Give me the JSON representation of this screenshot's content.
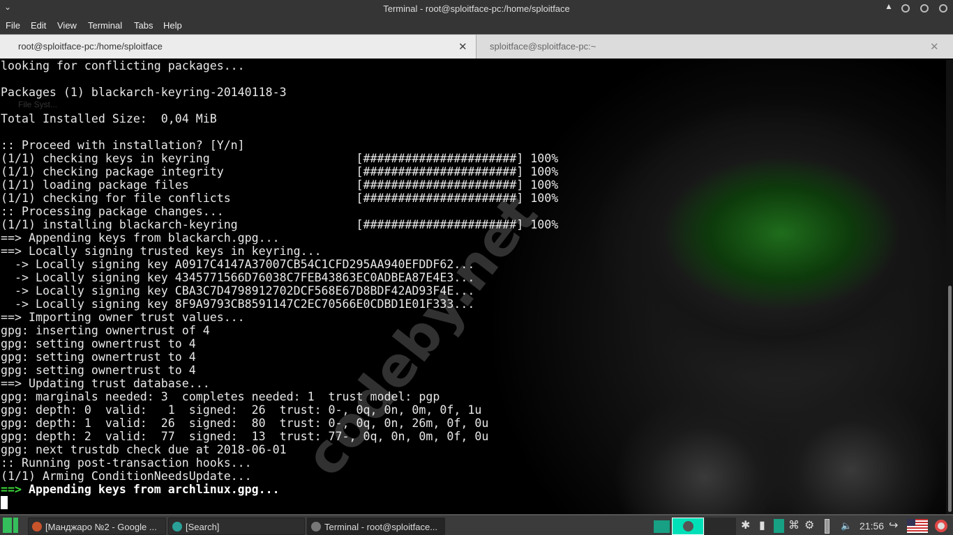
{
  "window": {
    "title": "Terminal - root@sploitface-pc:/home/sploitface"
  },
  "menu": [
    "File",
    "Edit",
    "View",
    "Terminal",
    "Tabs",
    "Help"
  ],
  "tabs": [
    {
      "label": "root@sploitface-pc:/home/sploitface",
      "active": true
    },
    {
      "label": "sploitface@sploitface-pc:~",
      "active": false
    }
  ],
  "desktop_icon": "File Syst...",
  "watermark": "codeby.net",
  "terminal": {
    "lines": [
      "looking for conflicting packages...",
      "",
      "Packages (1) blackarch-keyring-20140118-3",
      "",
      "Total Installed Size:  0,04 MiB",
      "",
      ":: Proceed with installation? [Y/n]",
      "(1/1) checking keys in keyring                     [######################] 100%",
      "(1/1) checking package integrity                   [######################] 100%",
      "(1/1) loading package files                        [######################] 100%",
      "(1/1) checking for file conflicts                  [######################] 100%",
      ":: Processing package changes...",
      "(1/1) installing blackarch-keyring                 [######################] 100%",
      "==> Appending keys from blackarch.gpg...",
      "==> Locally signing trusted keys in keyring...",
      "  -> Locally signing key A0917C4147A37007CB54C1CFD295AA940EFDDF62...",
      "  -> Locally signing key 4345771566D76038C7FEB43863EC0ADBEA87E4E3...",
      "  -> Locally signing key CBA3C7D4798912702DCF568E67D8BDF42AD93F4E...",
      "  -> Locally signing key 8F9A9793CB8591147C2EC70566E0CDBD1E01F333...",
      "==> Importing owner trust values...",
      "gpg: inserting ownertrust of 4",
      "gpg: setting ownertrust to 4",
      "gpg: setting ownertrust to 4",
      "gpg: setting ownertrust to 4",
      "==> Updating trust database...",
      "gpg: marginals needed: 3  completes needed: 1  trust model: pgp",
      "gpg: depth: 0  valid:   1  signed:  26  trust: 0-, 0q, 0n, 0m, 0f, 1u",
      "gpg: depth: 1  valid:  26  signed:  80  trust: 0-, 0q, 0n, 26m, 0f, 0u",
      "gpg: depth: 2  valid:  77  signed:  13  trust: 77-, 0q, 0n, 0m, 0f, 0u",
      "gpg: next trustdb check due at 2018-06-01",
      ":: Running post-transaction hooks...",
      "(1/1) Arming ConditionNeedsUpdate..."
    ],
    "last_line": {
      "arrow": "==>",
      "text": " Appending keys from archlinux.gpg..."
    }
  },
  "taskbar": {
    "items": [
      {
        "label": "[Манджаро №2 - Google ..."
      },
      {
        "label": "[Search]"
      },
      {
        "label": "Terminal - root@sploitface..."
      }
    ],
    "clock": "21:56",
    "accent": "#00e0b8"
  }
}
